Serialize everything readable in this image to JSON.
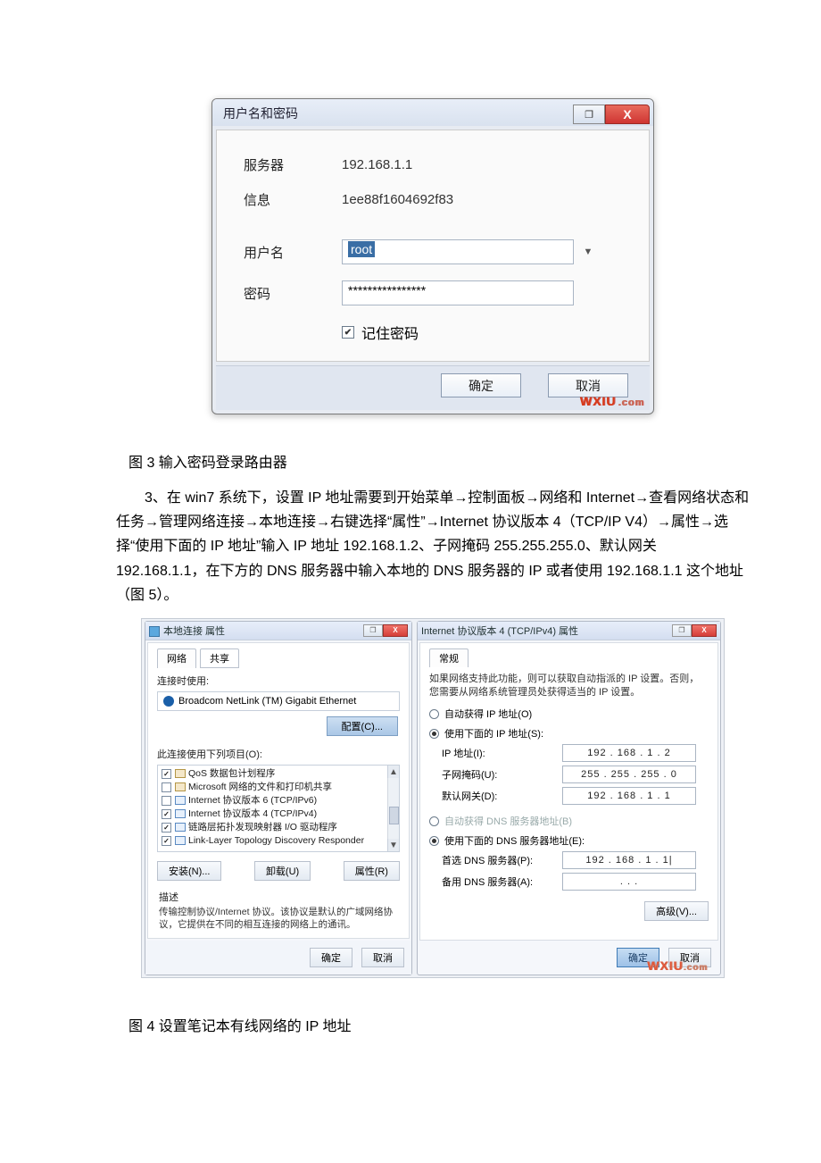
{
  "login_dialog": {
    "title": "用户名和密码",
    "server_label": "服务器",
    "server_value": "192.168.1.1",
    "info_label": "信息",
    "info_value": "1ee88f1604692f83",
    "user_label": "用户名",
    "user_value": "root",
    "dropdown_glyph": "▼",
    "pwd_label": "密码",
    "pwd_value": "****************",
    "remember_label": "记住密码",
    "remember_check": "✔",
    "ok": "确定",
    "cancel": "取消",
    "watermark": "WXIU",
    "watermark_suffix": ".com",
    "help_glyph": "❐",
    "close_glyph": "X"
  },
  "caption1": "图 3 输入密码登录路由器",
  "paragraph": "3、在 win7 系统下，设置 IP 地址需要到开始菜单→控制面板→网络和 Internet→查看网络状态和任务→管理网络连接→本地连接→右键选择“属性”→Internet 协议版本 4（TCP/IP V4）→属性→选择“使用下面的 IP 地址”输入 IP 地址 192.168.1.2、子网掩码 255.255.255.0、默认网关 192.168.1.1，在下方的 DNS 服务器中输入本地的 DNS 服务器的 IP 或者使用 192.168.1.1 这个地址（图 5）。",
  "left_dialog": {
    "title": "本地连接 属性",
    "tab_net": "网络",
    "tab_share": "共享",
    "connect_label": "连接时使用:",
    "adapter": "Broadcom NetLink (TM) Gigabit Ethernet",
    "config_btn": "配置(C)...",
    "list_label": "此连接使用下列项目(O):",
    "items": [
      {
        "checked": true,
        "iconClass": "net",
        "text": "QoS 数据包计划程序"
      },
      {
        "checked": false,
        "iconClass": "net",
        "text": "Microsoft 网络的文件和打印机共享"
      },
      {
        "checked": false,
        "iconClass": "",
        "text": "Internet 协议版本 6 (TCP/IPv6)"
      },
      {
        "checked": true,
        "iconClass": "",
        "text": "Internet 协议版本 4 (TCP/IPv4)"
      },
      {
        "checked": true,
        "iconClass": "",
        "text": "链路层拓扑发现映射器 I/O 驱动程序"
      },
      {
        "checked": true,
        "iconClass": "",
        "text": "Link-Layer Topology Discovery Responder"
      }
    ],
    "install_btn": "安装(N)...",
    "uninstall_btn": "卸载(U)",
    "prop_btn": "属性(R)",
    "desc_head": "描述",
    "desc_body": "传输控制协议/Internet 协议。该协议是默认的广域网络协议，它提供在不同的相互连接的网络上的通讯。",
    "ok": "确定",
    "cancel": "取消",
    "help_glyph": "❐",
    "close_glyph": "X",
    "scroll_up": "▲",
    "scroll_down": "▼"
  },
  "right_dialog": {
    "title": "Internet 协议版本 4 (TCP/IPv4) 属性",
    "tab_general": "常规",
    "msg": "如果网络支持此功能，则可以获取自动指派的 IP 设置。否则，您需要从网络系统管理员处获得适当的 IP 设置。",
    "auto_ip": "自动获得 IP 地址(O)",
    "use_ip": "使用下面的 IP 地址(S):",
    "ip_label": "IP 地址(I):",
    "ip_value": "192 . 168 .   1  .  2",
    "mask_label": "子网掩码(U):",
    "mask_value": "255 . 255 . 255 .  0",
    "gw_label": "默认网关(D):",
    "gw_value": "192 . 168 .   1  .  1",
    "auto_dns": "自动获得 DNS 服务器地址(B)",
    "use_dns": "使用下面的 DNS 服务器地址(E):",
    "pref_dns_label": "首选 DNS 服务器(P):",
    "pref_dns_value": "192 . 168 .   1  .  1|",
    "alt_dns_label": "备用 DNS 服务器(A):",
    "alt_dns_value": "  .       .       .  ",
    "advanced": "高级(V)...",
    "ok": "确定",
    "cancel": "取消",
    "help_glyph": "❐",
    "close_glyph": "X",
    "watermark": "WXIU",
    "watermark_suffix": ".com"
  },
  "caption2": "图 4 设置笔记本有线网络的 IP 地址"
}
